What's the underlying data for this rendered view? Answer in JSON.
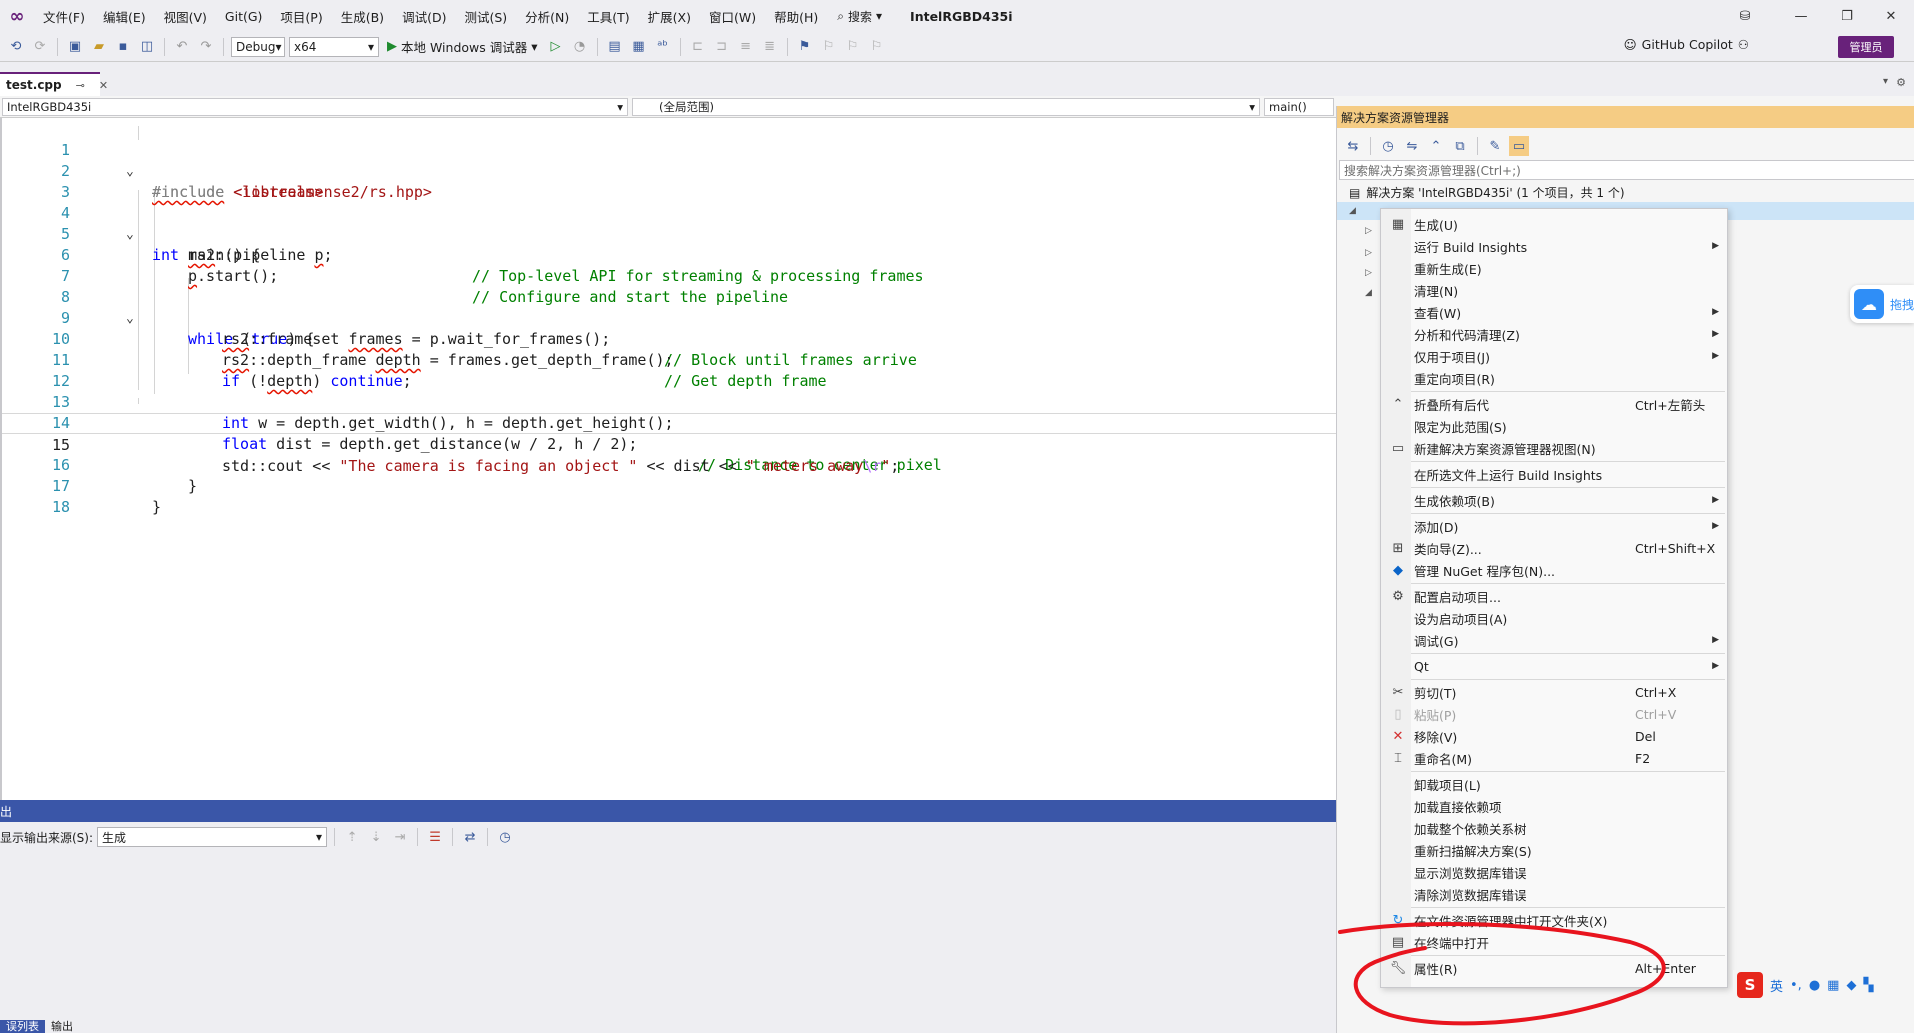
{
  "menubar": {
    "items": [
      "文件(F)",
      "编辑(E)",
      "视图(V)",
      "Git(G)",
      "项目(P)",
      "生成(B)",
      "调试(D)",
      "测试(S)",
      "分析(N)",
      "工具(T)",
      "扩展(X)",
      "窗口(W)",
      "帮助(H)"
    ],
    "search_label": "搜索",
    "window_title": "IntelRGBD435i"
  },
  "toolbar": {
    "config": "Debug",
    "platform": "x64",
    "run_label": "本地 Windows 调试器",
    "copilot_label": "GitHub Copilot",
    "admin_label": "管理员"
  },
  "document_tab": {
    "name": "test.cpp"
  },
  "navbar": {
    "project": "IntelRGBD435i",
    "scope": "(全局范围)",
    "member": "main()"
  },
  "editor": {
    "current_line": 15,
    "line_numbers": [
      "1",
      "2",
      "3",
      "4",
      "5",
      "6",
      "7",
      "8",
      "9",
      "10",
      "11",
      "12",
      "13",
      "14",
      "15",
      "16",
      "17",
      "18"
    ],
    "code": {
      "l1a": "#include",
      "l1b": "<librealsense2/rs.hpp>",
      "l2a": "#include",
      "l2b": "<iostream>",
      "l4a": "int",
      "l4b": " main() {",
      "l5a": "rs2",
      "l5b": "::pipeline ",
      "l5c": "p",
      "l5d": ";",
      "l5e": "// Top-level API for streaming & processing frames",
      "l6a": "p",
      "l6b": ".start();",
      "l6c": "// Configure and start the pipeline",
      "l8a": "while",
      "l8b": " (",
      "l8c": "true",
      "l8d": ") {",
      "l9a": "rs2",
      "l9b": "::frameset ",
      "l9c": "frames",
      "l9d": " = p.wait_for_frames();",
      "l9e": "// Block until frames arrive",
      "l10a": "rs2",
      "l10b": "::depth_frame ",
      "l10c": "depth",
      "l10d": " = frames.get_depth_frame();",
      "l10e": "// Get depth frame",
      "l11a": "if",
      "l11b": " (!",
      "l11c": "depth",
      "l11d": ") ",
      "l11e": "continue",
      "l13a": "int",
      "l13b": " w = depth.get_width(), h = depth.get_height();",
      "l14a": "float",
      "l14b": " dist = depth.get_distance(w / 2, h / 2);",
      "l14c": "// Distance to center pixel",
      "l15a": "std::cout << ",
      "l15b": "\"The camera is facing an object \"",
      "l15c": " << dist << ",
      "l15d": "\" meters away",
      "l15e": "\\r",
      "l15f": "\"",
      "l15g": ";",
      "l16": "}",
      "l17": "}"
    }
  },
  "output": {
    "title": "出",
    "source_label": "显示输出来源(S):",
    "source_value": "生成"
  },
  "bottom_tabs": [
    "误列表",
    "输出"
  ],
  "solution_explorer": {
    "title": "解决方案资源管理器",
    "search_placeholder": "搜索解决方案资源管理器(Ctrl+;)",
    "solution_label": "解决方案 'IntelRGBD435i' (1 个项目，共 1 个)"
  },
  "context_menu": {
    "items": [
      {
        "label": "生成(U)",
        "shortcut": "",
        "icon": "build-icon",
        "submenu": false
      },
      {
        "label": "运行 Build Insights",
        "shortcut": "",
        "icon": "",
        "submenu": true
      },
      {
        "label": "重新生成(E)",
        "shortcut": "",
        "icon": "",
        "submenu": false
      },
      {
        "label": "清理(N)",
        "shortcut": "",
        "icon": "",
        "submenu": false
      },
      {
        "label": "查看(W)",
        "shortcut": "",
        "icon": "",
        "submenu": true
      },
      {
        "label": "分析和代码清理(Z)",
        "shortcut": "",
        "icon": "",
        "submenu": true
      },
      {
        "label": "仅用于项目(J)",
        "shortcut": "",
        "icon": "",
        "submenu": true
      },
      {
        "label": "重定向项目(R)",
        "shortcut": "",
        "icon": "",
        "submenu": false
      },
      {
        "label": "折叠所有后代",
        "shortcut": "Ctrl+左箭头",
        "icon": "collapse-icon",
        "submenu": false
      },
      {
        "label": "限定为此范围(S)",
        "shortcut": "",
        "icon": "",
        "submenu": false
      },
      {
        "label": "新建解决方案资源管理器视图(N)",
        "shortcut": "",
        "icon": "new-view-icon",
        "submenu": false
      },
      {
        "label": "在所选文件上运行 Build Insights",
        "shortcut": "",
        "icon": "",
        "submenu": false
      },
      {
        "label": "生成依赖项(B)",
        "shortcut": "",
        "icon": "",
        "submenu": true
      },
      {
        "label": "添加(D)",
        "shortcut": "",
        "icon": "",
        "submenu": true
      },
      {
        "label": "类向导(Z)...",
        "shortcut": "Ctrl+Shift+X",
        "icon": "class-wizard-icon",
        "submenu": false
      },
      {
        "label": "管理 NuGet 程序包(N)...",
        "shortcut": "",
        "icon": "nuget-icon",
        "submenu": false
      },
      {
        "label": "配置启动项目...",
        "shortcut": "",
        "icon": "gear-icon",
        "submenu": false
      },
      {
        "label": "设为启动项目(A)",
        "shortcut": "",
        "icon": "",
        "submenu": false
      },
      {
        "label": "调试(G)",
        "shortcut": "",
        "icon": "",
        "submenu": true
      },
      {
        "label": "Qt",
        "shortcut": "",
        "icon": "",
        "submenu": true
      },
      {
        "label": "剪切(T)",
        "shortcut": "Ctrl+X",
        "icon": "scissors-icon",
        "submenu": false
      },
      {
        "label": "粘贴(P)",
        "shortcut": "Ctrl+V",
        "icon": "paste-icon",
        "submenu": false
      },
      {
        "label": "移除(V)",
        "shortcut": "Del",
        "icon": "remove-icon",
        "submenu": false
      },
      {
        "label": "重命名(M)",
        "shortcut": "F2",
        "icon": "rename-icon",
        "submenu": false
      },
      {
        "label": "卸载项目(L)",
        "shortcut": "",
        "icon": "",
        "submenu": false
      },
      {
        "label": "加载直接依赖项",
        "shortcut": "",
        "icon": "",
        "submenu": false
      },
      {
        "label": "加载整个依赖关系树",
        "shortcut": "",
        "icon": "",
        "submenu": false
      },
      {
        "label": "重新扫描解决方案(S)",
        "shortcut": "",
        "icon": "",
        "submenu": false
      },
      {
        "label": "显示浏览数据库错误",
        "shortcut": "",
        "icon": "",
        "submenu": false
      },
      {
        "label": "清除浏览数据库错误",
        "shortcut": "",
        "icon": "",
        "submenu": false
      },
      {
        "label": "在文件资源管理器中打开文件夹(X)",
        "shortcut": "",
        "icon": "refresh-folder-icon",
        "submenu": false
      },
      {
        "label": "在终端中打开",
        "shortcut": "",
        "icon": "terminal-icon",
        "submenu": false
      },
      {
        "label": "属性(R)",
        "shortcut": "Alt+Enter",
        "icon": "wrench-icon",
        "submenu": false
      }
    ]
  },
  "cloud_badge": {
    "label": "拖拽"
  },
  "ime_bar": {
    "logo": "S",
    "lang": "英"
  },
  "annotation": {
    "color": "#e8141e"
  },
  "colors": {
    "accent": "#68217a",
    "tool_window_title": "#f5cc84",
    "status_blue": "#3a56a8"
  }
}
